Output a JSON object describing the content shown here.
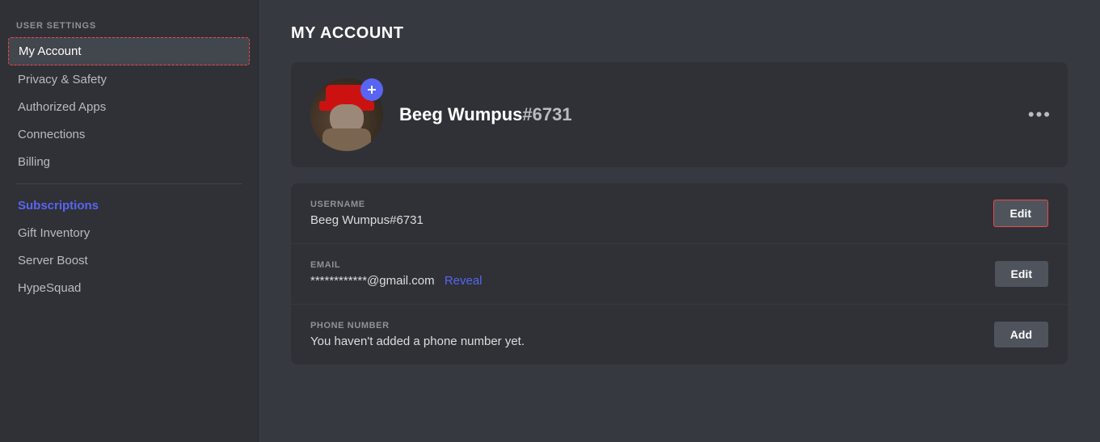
{
  "sidebar": {
    "section_label": "USER SETTINGS",
    "items": [
      {
        "id": "my-account",
        "label": "My Account",
        "active": true,
        "blue": false
      },
      {
        "id": "privacy-safety",
        "label": "Privacy & Safety",
        "active": false,
        "blue": false
      },
      {
        "id": "authorized-apps",
        "label": "Authorized Apps",
        "active": false,
        "blue": false
      },
      {
        "id": "connections",
        "label": "Connections",
        "active": false,
        "blue": false
      },
      {
        "id": "billing",
        "label": "Billing",
        "active": false,
        "blue": false
      },
      {
        "id": "subscriptions",
        "label": "Subscriptions",
        "active": false,
        "blue": true
      },
      {
        "id": "gift-inventory",
        "label": "Gift Inventory",
        "active": false,
        "blue": false
      },
      {
        "id": "server-boost",
        "label": "Server Boost",
        "active": false,
        "blue": false
      },
      {
        "id": "hypesquad",
        "label": "HypeSquad",
        "active": false,
        "blue": false
      }
    ]
  },
  "main": {
    "page_title": "MY ACCOUNT",
    "profile": {
      "username": "Beeg Wumpus",
      "discriminator": "#6731",
      "full_username": "Beeg Wumpus#6731",
      "more_btn_label": "•••"
    },
    "fields": [
      {
        "id": "username-field",
        "label": "USERNAME",
        "value": "Beeg Wumpus#6731",
        "reveal_text": null,
        "action_label": "Edit",
        "action_outlined": true
      },
      {
        "id": "email-field",
        "label": "EMAIL",
        "value": "************@gmail.com",
        "reveal_text": "Reveal",
        "action_label": "Edit",
        "action_outlined": false
      },
      {
        "id": "phone-field",
        "label": "PHONE NUMBER",
        "value": "You haven't added a phone number yet.",
        "reveal_text": null,
        "action_label": "Add",
        "action_outlined": false
      }
    ],
    "avatar_edit_icon": "➕",
    "edit_label": "Edit",
    "add_label": "Add"
  }
}
